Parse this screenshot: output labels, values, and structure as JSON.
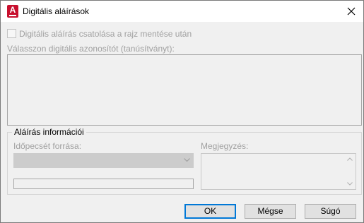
{
  "window": {
    "title": "Digitális aláírások",
    "icon": "autocad-app-icon",
    "icon_letter": "A"
  },
  "attach_checkbox": {
    "label": "Digitális aláírás csatolása a rajz mentése után",
    "checked": false,
    "enabled": false
  },
  "certificate_list": {
    "label": "Válasszon digitális azonosítót (tanúsítványt):",
    "items": []
  },
  "signature_info": {
    "group_title": "Aláírás információi",
    "timestamp_label": "Időpecsét forrása:",
    "timestamp_value": "",
    "comment_label": "Megjegyzés:",
    "comment_value": ""
  },
  "buttons": {
    "ok": "OK",
    "cancel": "Mégse",
    "help": "Súgó"
  },
  "colors": {
    "accent": "#0078d7",
    "disabled_text": "#a0a0a0",
    "dialog_bg": "#f0f0f0",
    "app_icon_red": "#c8102e"
  }
}
